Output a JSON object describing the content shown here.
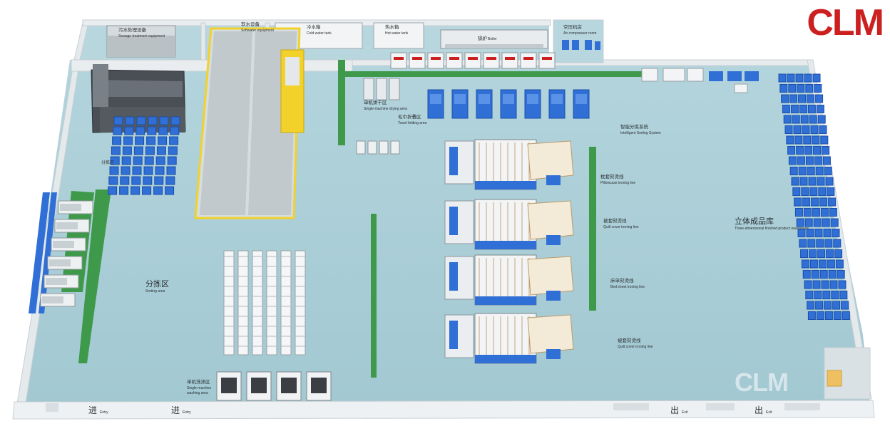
{
  "logo": "CLM",
  "watermark": "CLM",
  "colors": {
    "floor": "#a9cdd6",
    "wall": "#e9edef",
    "wall_edge": "#c9d0d4",
    "rack_blue": "#2f6fd6",
    "machine_white": "#f3f5f6",
    "machine_dark": "#3b3f44",
    "green_belt": "#3e9a4a",
    "yellow_frame": "#f2d22a",
    "logo_red": "#cc1f1f"
  },
  "labels": {
    "sewage": {
      "cn": "污水处理设备",
      "en": "Sewage treatment equipment"
    },
    "softwater": {
      "cn": "软水设备",
      "en": "Softwater equipment"
    },
    "coldwater": {
      "cn": "冷水箱",
      "en": "Cold water tank"
    },
    "hotwater": {
      "cn": "热水箱",
      "en": "Hot water tank"
    },
    "boiler": {
      "cn": "锅炉",
      "en": "Boiler"
    },
    "aircomp": {
      "cn": "空压机房",
      "en": "Air compressor room"
    },
    "single_dry": {
      "cn": "单机烘干区",
      "en": "Single-machine drying area"
    },
    "towel_fold": {
      "cn": "毛巾折叠区",
      "en": "Towel folding area"
    },
    "smart_sort": {
      "cn": "智能分拣系统",
      "en": "Intelligent Sorting System"
    },
    "pillow_line": {
      "cn": "枕套熨烫线",
      "en": "Pillowcase ironing line"
    },
    "quilt_line1": {
      "cn": "被套熨烫线",
      "en": "Quilt cover ironing line"
    },
    "bedsheet_line": {
      "cn": "床单熨烫线",
      "en": "Bed sheet ironing line"
    },
    "quilt_line2": {
      "cn": "被套熨烫线",
      "en": "Quilt cover ironing line"
    },
    "warehouse": {
      "cn": "立体成品库",
      "en": "Three-dimensional finished product warehouse"
    },
    "sorting": {
      "cn": "分拣区",
      "en": "Sorting area"
    },
    "single_wash": {
      "cn": "单机洗涤区",
      "en": "Single machine washing area"
    },
    "partial_cn": "分拣区",
    "entry1": {
      "cn": "进",
      "en": "Entry"
    },
    "entry2": {
      "cn": "进",
      "en": "Entry"
    },
    "exit1": {
      "cn": "出",
      "en": "Exit"
    },
    "exit2": {
      "cn": "出",
      "en": "Exit"
    }
  }
}
